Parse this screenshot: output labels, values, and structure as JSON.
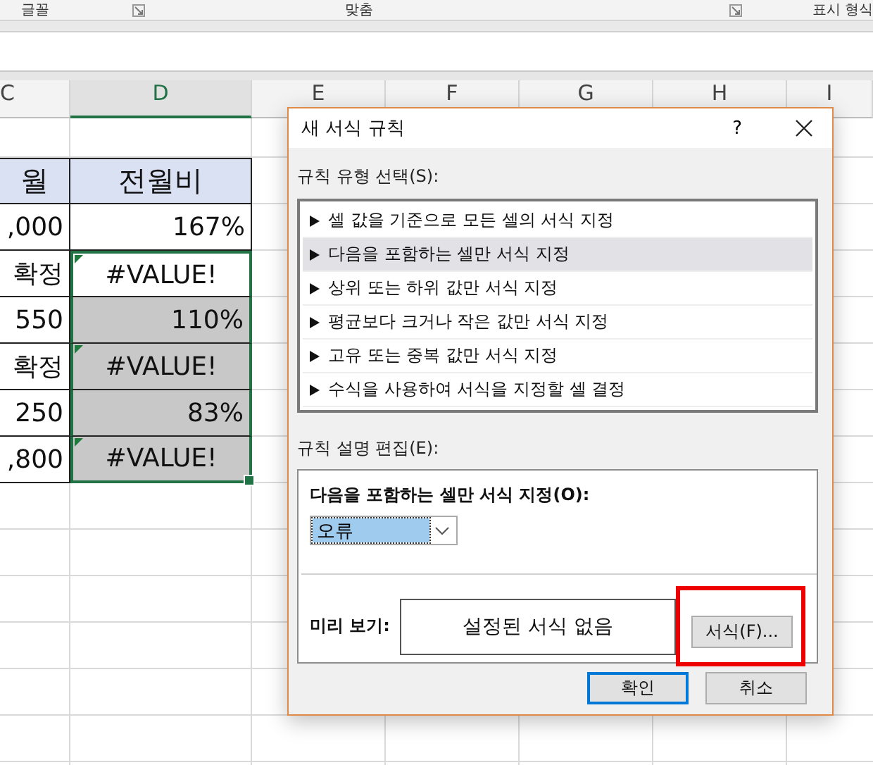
{
  "ribbon": {
    "groups": [
      {
        "label": "글꼴",
        "launcher": true
      },
      {
        "label": "맞춤",
        "launcher": true
      },
      {
        "label": "표시 형식",
        "launcher": false
      }
    ]
  },
  "sheet": {
    "columns": [
      {
        "label": "C",
        "selected": false
      },
      {
        "label": "D",
        "selected": true
      },
      {
        "label": "E",
        "selected": false
      },
      {
        "label": "F",
        "selected": false
      },
      {
        "label": "G",
        "selected": false
      },
      {
        "label": "H",
        "selected": false
      },
      {
        "label": "I",
        "selected": false
      }
    ],
    "rows": [
      {
        "kind": "header",
        "c": "월",
        "d": {
          "text": "전월비",
          "shaded": false,
          "flag": false
        },
        "selected": false
      },
      {
        "kind": "data",
        "c": ",000",
        "d": {
          "text": "167%",
          "shaded": false,
          "flag": false
        },
        "selected": false
      },
      {
        "kind": "data",
        "c": "확정",
        "d": {
          "text": "#VALUE!",
          "shaded": false,
          "flag": true
        },
        "selected": true
      },
      {
        "kind": "data",
        "c": "550",
        "d": {
          "text": "110%",
          "shaded": true,
          "flag": false
        },
        "selected": true
      },
      {
        "kind": "data",
        "c": "확정",
        "d": {
          "text": "#VALUE!",
          "shaded": true,
          "flag": true
        },
        "selected": true
      },
      {
        "kind": "data",
        "c": "250",
        "d": {
          "text": "83%",
          "shaded": true,
          "flag": false
        },
        "selected": true
      },
      {
        "kind": "data",
        "c": ",800",
        "d": {
          "text": "#VALUE!",
          "shaded": true,
          "flag": true
        },
        "selected": true
      }
    ]
  },
  "dialog": {
    "title": "새 서식 규칙",
    "help": "?",
    "rule_type_label": "규칙 유형 선택(S):",
    "rule_types": [
      {
        "label": "셀 값을 기준으로 모든 셀의 서식 지정",
        "selected": false
      },
      {
        "label": "다음을 포함하는 셀만 서식 지정",
        "selected": true
      },
      {
        "label": "상위 또는 하위 값만 서식 지정",
        "selected": false
      },
      {
        "label": "평균보다 크거나 작은 값만 서식 지정",
        "selected": false
      },
      {
        "label": "고유 또는 중복 값만 서식 지정",
        "selected": false
      },
      {
        "label": "수식을 사용하여 서식을 지정할 셀 결정",
        "selected": false
      }
    ],
    "description_label": "규칙 설명 편집(E):",
    "condition_label": "다음을 포함하는 셀만 서식 지정(O):",
    "condition_value": "오류",
    "preview_label": "미리 보기:",
    "preview_text": "설정된 서식 없음",
    "format_button": {
      "label": "서식(F)...",
      "highlighted": true
    },
    "buttons": [
      {
        "label": "확인",
        "default": true
      },
      {
        "label": "취소",
        "default": false
      }
    ]
  }
}
